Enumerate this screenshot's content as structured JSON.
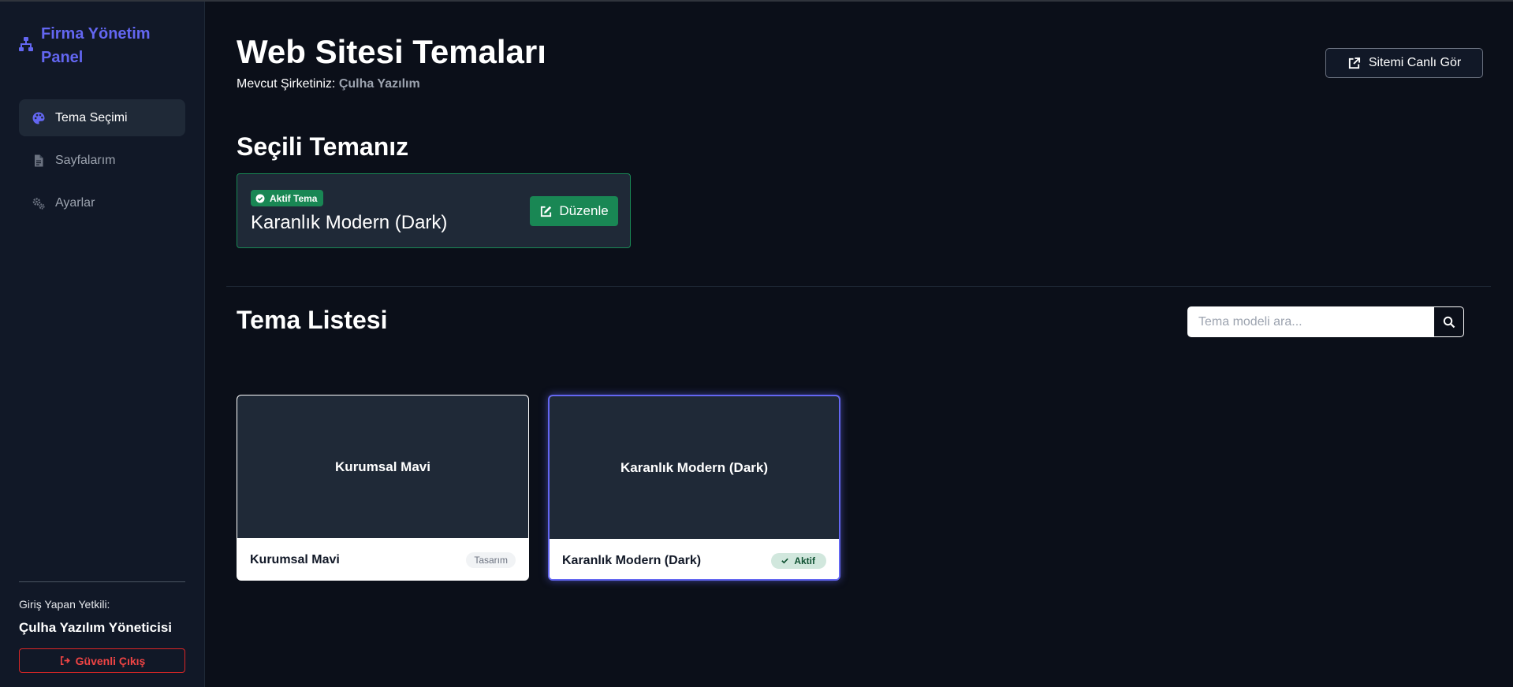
{
  "sidebar": {
    "brand": "Firma Yönetim Panel",
    "items": [
      {
        "label": "Tema Seçimi",
        "icon": "palette-icon",
        "active": true
      },
      {
        "label": "Sayfalarım",
        "icon": "file-icon",
        "active": false
      },
      {
        "label": "Ayarlar",
        "icon": "gears-icon",
        "active": false
      }
    ],
    "user_label": "Giriş Yapan Yetkili:",
    "user_name": "Çulha Yazılım Yöneticisi",
    "logout_label": "Güvenli Çıkış"
  },
  "header": {
    "title": "Web Sitesi Temaları",
    "company_prefix": "Mevcut Şirketiniz:",
    "company_name": "Çulha Yazılım",
    "live_button": "Sitemi Canlı Gör"
  },
  "selected_theme": {
    "section_title": "Seçili Temanız",
    "badge": "Aktif Tema",
    "name": "Karanlık Modern (Dark)",
    "edit_button": "Düzenle"
  },
  "theme_list": {
    "section_title": "Tema Listesi",
    "search_placeholder": "Tema modeli ara...",
    "themes": [
      {
        "preview_title": "Kurumsal Mavi",
        "name": "Kurumsal Mavi",
        "tag": "Tasarım",
        "selected": false
      },
      {
        "preview_title": "Karanlık Modern (Dark)",
        "name": "Karanlık Modern (Dark)",
        "tag": "Aktif",
        "selected": true
      }
    ]
  },
  "colors": {
    "background": "#0b0f19",
    "sidebar": "#111827",
    "accent": "#6366f1",
    "success": "#198754",
    "danger": "#dc2626"
  }
}
